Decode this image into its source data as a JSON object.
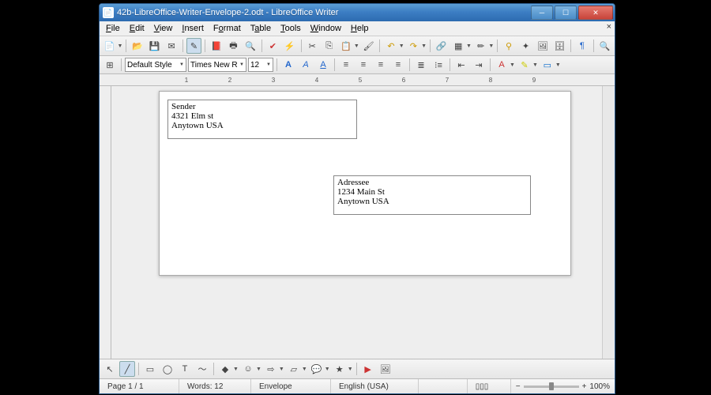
{
  "title": "42b-LibreOffice-Writer-Envelope-2.odt - LibreOffice Writer",
  "menu": {
    "file": "File",
    "edit": "Edit",
    "view": "View",
    "insert": "Insert",
    "format": "Format",
    "table": "Table",
    "tools": "Tools",
    "window": "Window",
    "help": "Help"
  },
  "format_bar": {
    "style": "Default Style",
    "font": "Times New Roman",
    "size": "12"
  },
  "ruler": {
    "marks": [
      "1",
      "2",
      "3",
      "4",
      "5",
      "6",
      "7",
      "8",
      "9"
    ]
  },
  "sender": {
    "l1": "Sender",
    "l2": "4321 Elm st",
    "l3": "Anytown USA"
  },
  "addressee": {
    "l1": "Adressee",
    "l2": "1234 Main St",
    "l3": "Anytown USA"
  },
  "status": {
    "page": "Page 1 / 1",
    "words": "Words: 12",
    "style": "Envelope",
    "lang": "English (USA)",
    "zoom": "100%"
  }
}
